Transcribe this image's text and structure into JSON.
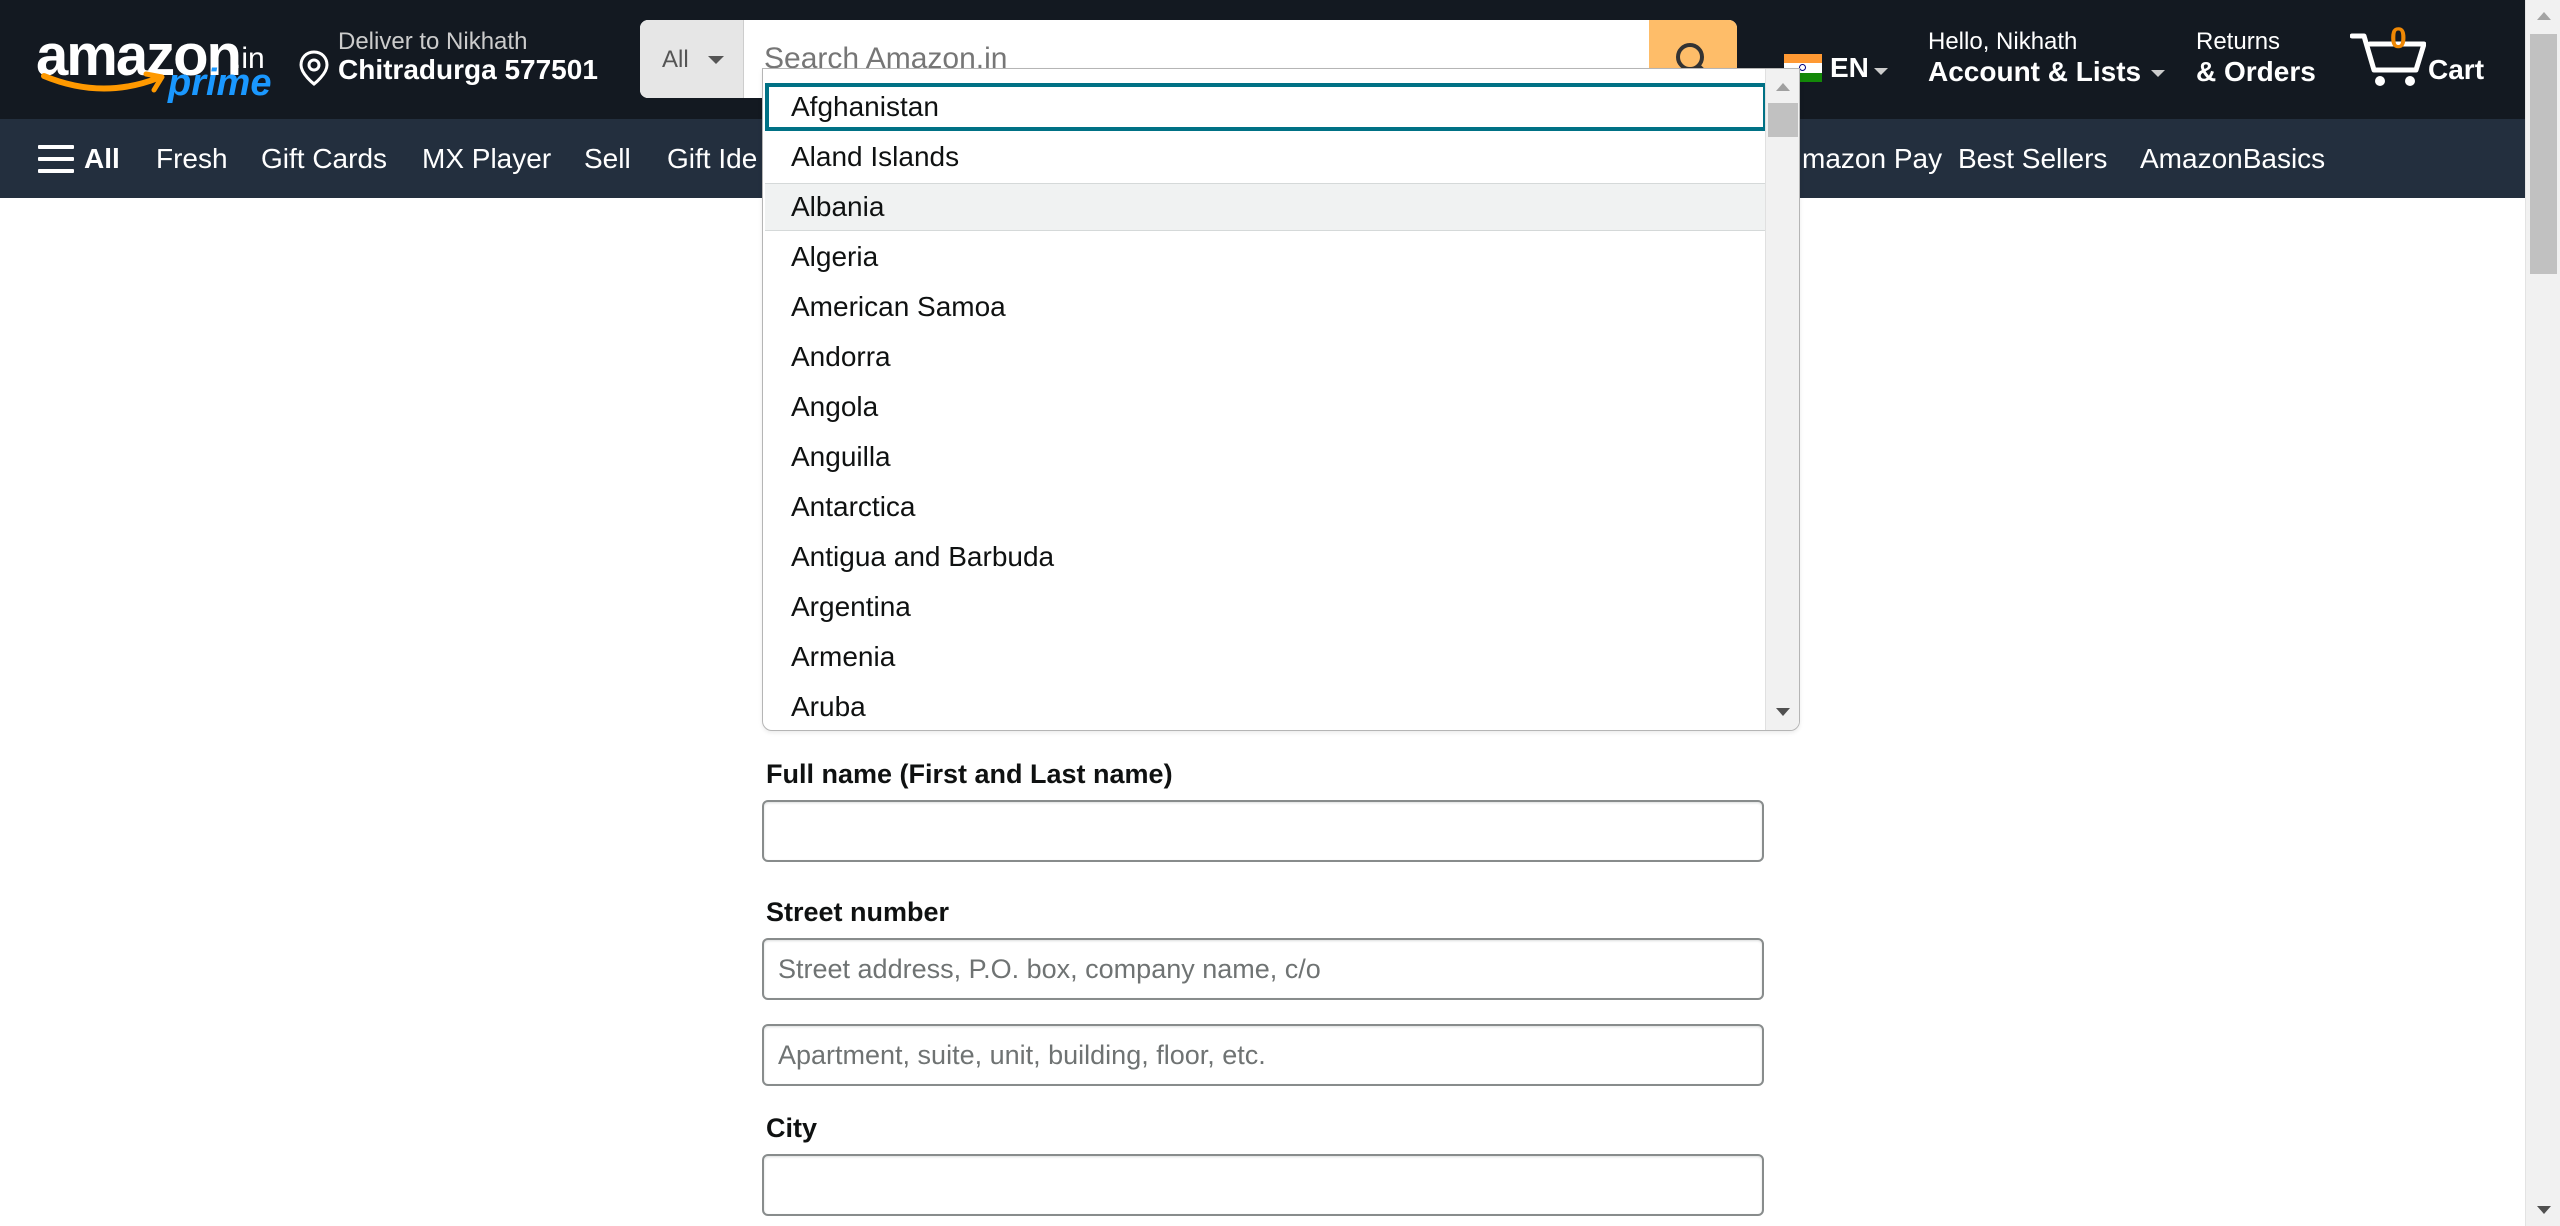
{
  "brand": {
    "wordmark": "amazon",
    "tld": ".in",
    "prime": "prime"
  },
  "delivery": {
    "line1": "Deliver to Nikhath",
    "line2": "Chitradurga 577501"
  },
  "search": {
    "category": "All",
    "placeholder": "Search Amazon.in"
  },
  "language": {
    "code": "EN"
  },
  "account": {
    "greeting": "Hello, Nikhath",
    "label": "Account & Lists"
  },
  "orders": {
    "line1": "Returns",
    "line2": "& Orders"
  },
  "cart": {
    "count": "0",
    "label": "Cart"
  },
  "subnav": {
    "all_label": "All",
    "items": [
      "Fresh",
      "Gift Cards",
      "MX Player",
      "Sell",
      "Gift Ide",
      "mazon Pay",
      "Best Sellers",
      "AmazonBasics"
    ]
  },
  "country_dropdown": {
    "options": [
      "Afghanistan",
      "Aland Islands",
      "Albania",
      "Algeria",
      "American Samoa",
      "Andorra",
      "Angola",
      "Anguilla",
      "Antarctica",
      "Antigua and Barbuda",
      "Argentina",
      "Armenia",
      "Aruba"
    ],
    "focused": "Afghanistan",
    "highlighted": "Albania"
  },
  "form": {
    "full_name_label": "Full name (First and Last name)",
    "full_name_value": "",
    "street_label": "Street number",
    "street_line1_placeholder": "Street address, P.O. box, company name, c/o",
    "street_line2_placeholder": "Apartment, suite, unit, building, floor, etc.",
    "city_label": "City",
    "city_value": ""
  },
  "colors": {
    "nav_bg": "#131921",
    "subnav_bg": "#232f3e",
    "search_button": "#febd69",
    "cart_count": "#f08804",
    "focus_ring": "#007185",
    "prime_blue": "#1a98ff"
  }
}
